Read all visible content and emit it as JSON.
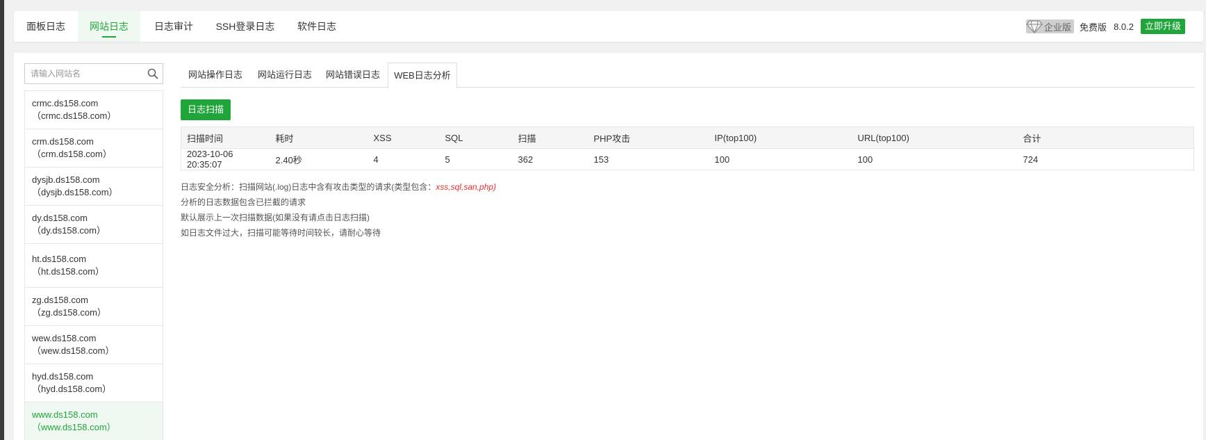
{
  "top_tabs": [
    "面板日志",
    "网站日志",
    "日志审计",
    "SSH登录日志",
    "软件日志"
  ],
  "header": {
    "enterprise_label": "企业版",
    "free_label": "免费版",
    "version": "8.0.2",
    "upgrade_label": "立即升级"
  },
  "search": {
    "placeholder": "请输入网站名"
  },
  "sites": [
    {
      "name": "crmc.ds158.com",
      "alias": "（crmc.ds158.com）"
    },
    {
      "name": "crm.ds158.com",
      "alias": "（crm.ds158.com）"
    },
    {
      "name": "dysjb.ds158.com",
      "alias": "（dysjb.ds158.com）"
    },
    {
      "name": "dy.ds158.com",
      "alias": "（dy.ds158.com）"
    },
    {
      "name": "ht.ds158.com",
      "alias": "（ht.ds158.com）"
    },
    {
      "name": "zg.ds158.com",
      "alias": "（zg.ds158.com）"
    },
    {
      "name": "wew.ds158.com",
      "alias": "（wew.ds158.com）"
    },
    {
      "name": "hyd.ds158.com",
      "alias": "（hyd.ds158.com）"
    },
    {
      "name": "www.ds158.com",
      "alias": "（www.ds158.com）"
    }
  ],
  "sub_tabs": [
    "网站操作日志",
    "网站运行日志",
    "网站错误日志",
    "WEB日志分析"
  ],
  "scan_button": "日志扫描",
  "table": {
    "headers": [
      "扫描时间",
      "耗时",
      "XSS",
      "SQL",
      "扫描",
      "PHP攻击",
      "IP(top100)",
      "URL(top100)",
      "合计"
    ],
    "row": [
      "2023-10-06 20:35:07",
      "2.40秒",
      "4",
      "5",
      "362",
      "153",
      "100",
      "100",
      "724"
    ]
  },
  "notes": {
    "line1_prefix": "日志安全分析：扫描网站(.log)日志中含有攻击类型的请求(类型包含：",
    "line1_types": "xss,sql,san,php",
    "line1_suffix": ")",
    "line2": "分析的日志数据包含已拦截的请求",
    "line3": "默认展示上一次扫描数据(如果没有请点击日志扫描)",
    "line4": "如日志文件过大，扫描可能等待时间较长，请耐心等待"
  },
  "colors": {
    "accent": "#20a53a",
    "danger": "#e42d2d"
  },
  "icons": {
    "enterprise": "diamond-icon",
    "search": "search-icon"
  }
}
